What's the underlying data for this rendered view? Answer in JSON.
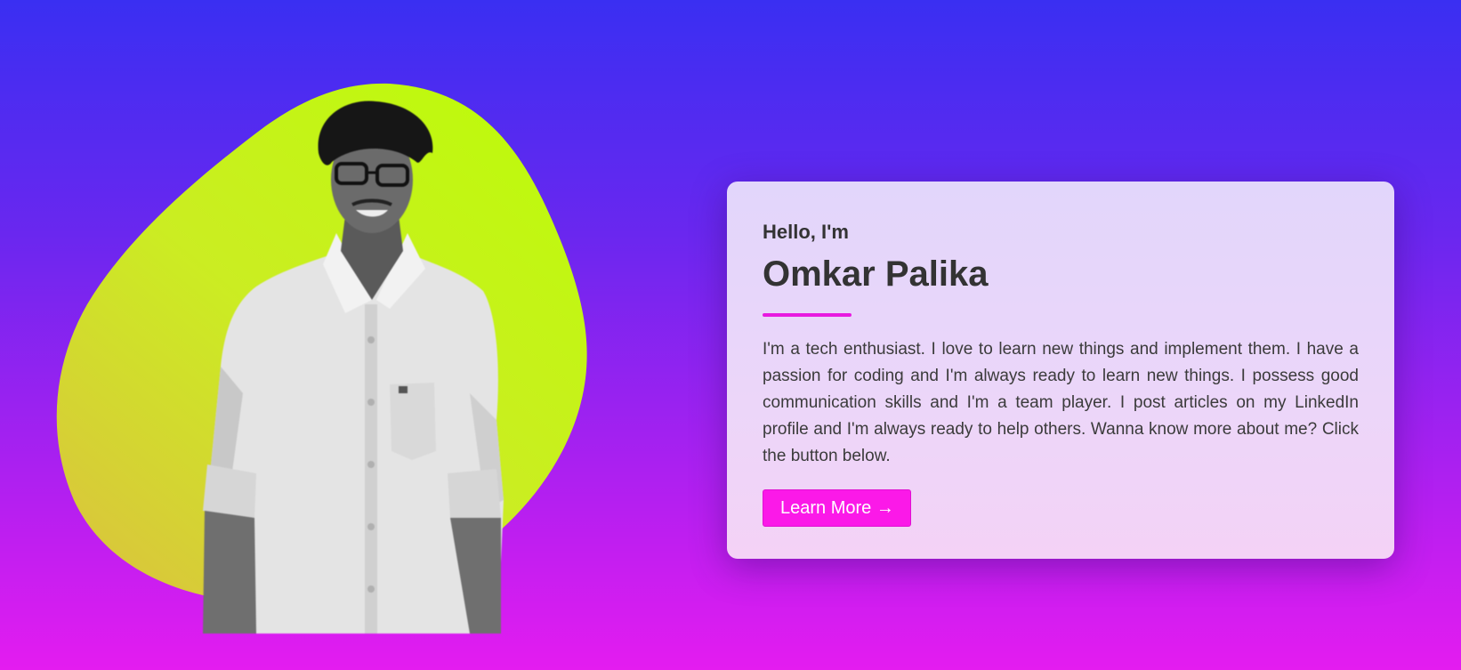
{
  "hero": {
    "greeting": "Hello, I'm",
    "name": "Omkar Palika",
    "bio": "I'm a tech enthusiast. I love to learn new things and implement them. I have a passion for coding and I'm always ready to learn new things. I possess good communication skills and I'm a team player. I post articles on my LinkedIn profile and I'm always ready to help others. Wanna know more about me? Click the button below.",
    "button_label": "Learn More →"
  },
  "colors": {
    "background_top": "#3a2ff2",
    "background_bottom": "#e41cf0",
    "blob": "#c4f510",
    "accent": "#fb19e8"
  },
  "icons": {
    "arrow": "right-arrow"
  }
}
